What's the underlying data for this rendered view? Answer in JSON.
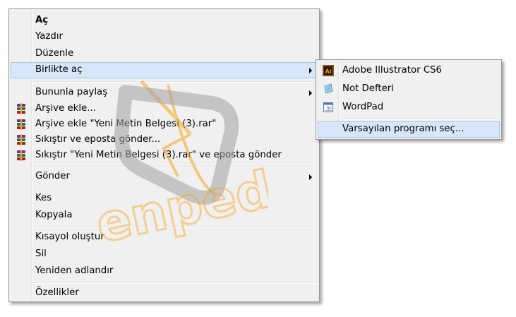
{
  "main_menu": {
    "items": [
      {
        "label": "Aç"
      },
      {
        "label": "Yazdır"
      },
      {
        "label": "Düzenle"
      },
      {
        "label": "Birlikte aç"
      },
      {
        "label": "Bununla paylaş"
      },
      {
        "label": "Arşive ekle...",
        "icon": "winrar-icon"
      },
      {
        "label": "Arşive ekle \"Yeni Metin Belgesi (3).rar\"",
        "icon": "winrar-icon"
      },
      {
        "label": "Sıkıştır ve eposta gönder...",
        "icon": "winrar-icon"
      },
      {
        "label": "Sıkıştır \"Yeni Metin Belgesi (3).rar\" ve eposta gönder",
        "icon": "winrar-icon"
      },
      {
        "label": "Gönder"
      },
      {
        "label": "Kes"
      },
      {
        "label": "Kopyala"
      },
      {
        "label": "Kısayol oluştur"
      },
      {
        "label": "Sil"
      },
      {
        "label": "Yeniden adlandır"
      },
      {
        "label": "Özellikler"
      }
    ]
  },
  "sub_menu": {
    "items": [
      {
        "label": "Adobe Illustrator CS6",
        "icon": "illustrator-icon",
        "icon_text": "Ai"
      },
      {
        "label": "Not Defteri",
        "icon": "notepad-icon"
      },
      {
        "label": "WordPad",
        "icon": "wordpad-icon"
      },
      {
        "label": "Varsayılan programı seç..."
      }
    ]
  },
  "watermark": {
    "text": "enpedi"
  },
  "colors": {
    "menu_bg": "#f0f0f0",
    "highlight_bg": "#d7e6f8",
    "highlight_border": "#a4c3e8",
    "watermark_orange": "#f5a623",
    "watermark_gray": "#a0a0a0"
  }
}
